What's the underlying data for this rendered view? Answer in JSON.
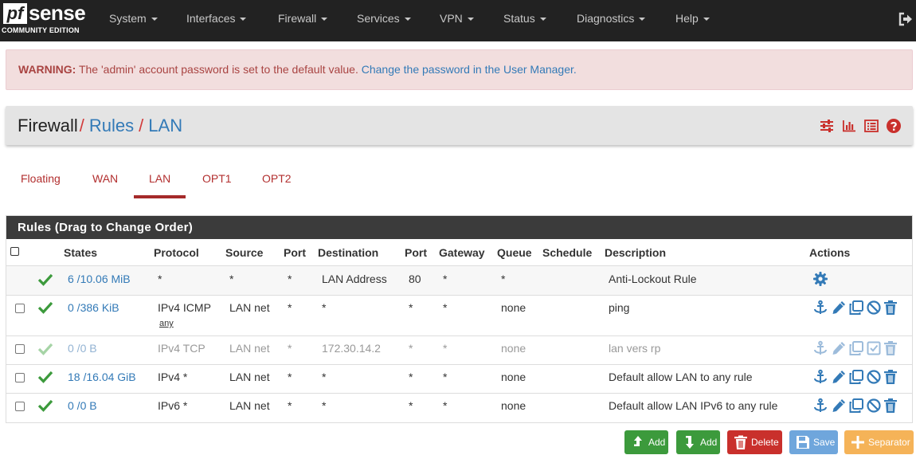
{
  "brand": {
    "logo_mark": "pf",
    "logo_word": "sense",
    "edition": "COMMUNITY EDITION"
  },
  "nav": {
    "items": [
      "System",
      "Interfaces",
      "Firewall",
      "Services",
      "VPN",
      "Status",
      "Diagnostics",
      "Help"
    ],
    "logout_icon": "sign-out-icon"
  },
  "warning": {
    "label": "WARNING:",
    "message": " The 'admin' account password is set to the default value. ",
    "link": "Change the password in the User Manager."
  },
  "breadcrumb": {
    "root": "Firewall",
    "sep": "/",
    "level2": "Rules",
    "level3": "LAN"
  },
  "toolbar_icons": [
    "sliders-icon",
    "bar-chart-icon",
    "list-icon",
    "help-icon"
  ],
  "tabs": [
    "Floating",
    "WAN",
    "LAN",
    "OPT1",
    "OPT2"
  ],
  "active_tab": "LAN",
  "panel": {
    "title": "Rules (Drag to Change Order)"
  },
  "columns": [
    "States",
    "Protocol",
    "Source",
    "Port",
    "Destination",
    "Port",
    "Gateway",
    "Queue",
    "Schedule",
    "Description",
    "Actions"
  ],
  "rows": [
    {
      "states": "6 /10.06 MiB",
      "protocol": "*",
      "source": "*",
      "sport": "*",
      "destination": "LAN Address",
      "dport": "80",
      "gateway": "*",
      "queue": "*",
      "schedule": "",
      "description": "Anti-Lockout Rule",
      "enabled": true,
      "selectable": false
    },
    {
      "states": "0 /386 KiB",
      "protocol": "IPv4 ICMP",
      "protocol_sub": "any",
      "source": "LAN net",
      "sport": "*",
      "destination": "*",
      "dport": "*",
      "gateway": "*",
      "queue": "none",
      "schedule": "",
      "description": "ping",
      "enabled": true,
      "selectable": true
    },
    {
      "states": "0 /0 B",
      "protocol": "IPv4 TCP",
      "source": "LAN net",
      "sport": "*",
      "destination": "172.30.14.2",
      "dport": "*",
      "gateway": "*",
      "queue": "none",
      "schedule": "",
      "description": "lan vers rp",
      "enabled": false,
      "selectable": true
    },
    {
      "states": "18 /16.04 GiB",
      "protocol": "IPv4 *",
      "source": "LAN net",
      "sport": "*",
      "destination": "*",
      "dport": "*",
      "gateway": "*",
      "queue": "none",
      "schedule": "",
      "description": "Default allow LAN to any rule",
      "enabled": true,
      "selectable": true
    },
    {
      "states": "0 /0 B",
      "protocol": "IPv6 *",
      "source": "LAN net",
      "sport": "*",
      "destination": "*",
      "dport": "*",
      "gateway": "*",
      "queue": "none",
      "schedule": "",
      "description": "Default allow LAN IPv6 to any rule",
      "enabled": true,
      "selectable": true
    }
  ],
  "buttons": [
    {
      "label": "Add",
      "icon": "arrow-up-add-top-icon",
      "color": "#3c9a3c"
    },
    {
      "label": "Add",
      "icon": "arrow-down-add-bottom-icon",
      "color": "#3c9a3c"
    },
    {
      "label": "Delete",
      "icon": "trash-icon",
      "color": "#c9302c"
    },
    {
      "label": "Save",
      "icon": "save-icon",
      "color": "#6fa6dc"
    },
    {
      "label": "Separator",
      "icon": "plus-icon",
      "color": "#f5b358"
    }
  ],
  "colors": {
    "link": "#337ab7",
    "danger": "#c9302c",
    "success": "#3c9a3c",
    "navbar": "#222222"
  }
}
